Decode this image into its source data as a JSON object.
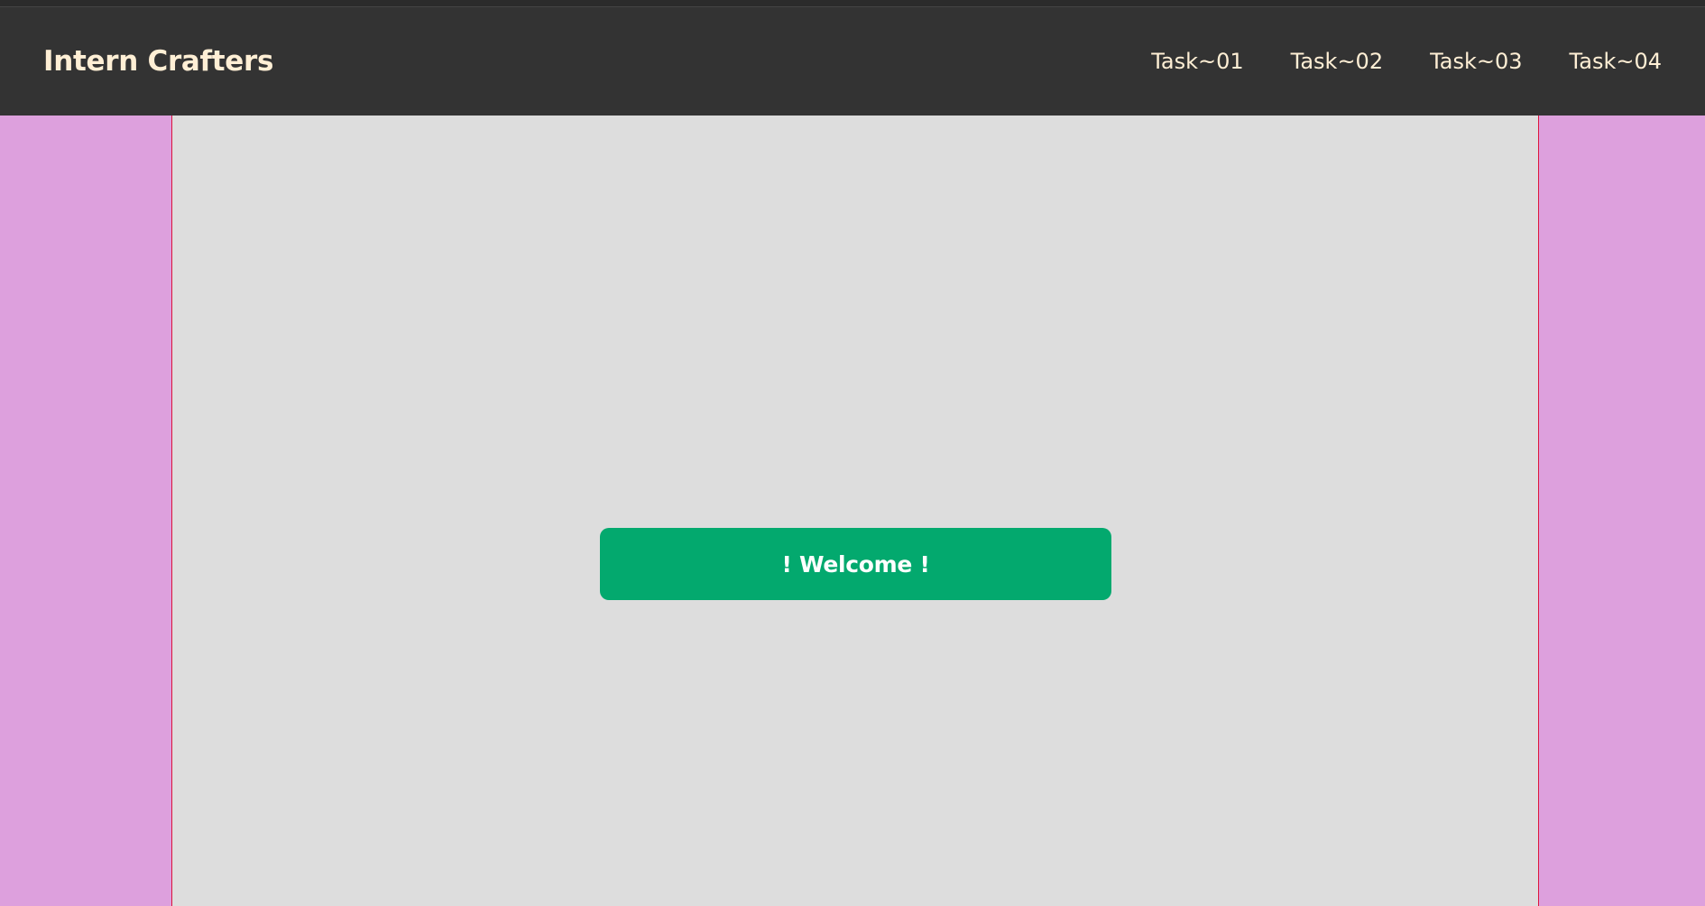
{
  "header": {
    "brand": "Intern Crafters",
    "nav": [
      {
        "label": "Task~01"
      },
      {
        "label": "Task~02"
      },
      {
        "label": "Task~03"
      },
      {
        "label": "Task~04"
      }
    ]
  },
  "main": {
    "welcome_text": "! Welcome !"
  },
  "colors": {
    "page_background": "#dda0dd",
    "navbar_background": "#333333",
    "brand_text": "#ffefd5",
    "content_background": "#dddddd",
    "content_border": "#dc143c",
    "welcome_background": "#03a96e",
    "welcome_text": "#ffffff"
  }
}
